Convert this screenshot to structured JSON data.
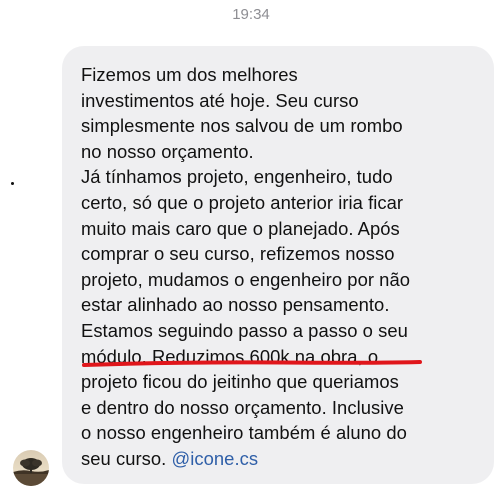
{
  "header": {
    "timestamp": "19:34"
  },
  "message": {
    "lines": [
      "Fizemos um dos melhores",
      "investimentos até hoje. Seu curso",
      "simplesmente nos salvou de um rombo",
      "no nosso orçamento.",
      "Já tínhamos projeto, engenheiro, tudo",
      "certo, só que o projeto anterior iria ficar",
      "muito mais caro que o planejado. Após",
      "comprar o seu curso, refizemos nosso",
      "projeto, mudamos o engenheiro por não",
      "estar alinhado ao nosso pensamento.",
      "Estamos seguindo passo a passo o seu"
    ],
    "line12_prefix": "módulo. ",
    "highlighted_text": "Reduzimos 600k na obra",
    "line12_suffix": ", o",
    "lines_after": [
      "projeto ficou do jeitinho que queriamos",
      "e dentro do nosso orçamento. Inclusive",
      "o nosso engenheiro também é aluno do"
    ],
    "last_line_prefix": "seu curso. ",
    "mention": "@icone.cs"
  },
  "colors": {
    "bubble": "#efeff1",
    "text": "#111111",
    "mention": "#2f5fa8",
    "underline": "#e0161b",
    "timestamp": "#8e8e93"
  },
  "icons": {
    "avatar": "profile-avatar-sunset"
  }
}
